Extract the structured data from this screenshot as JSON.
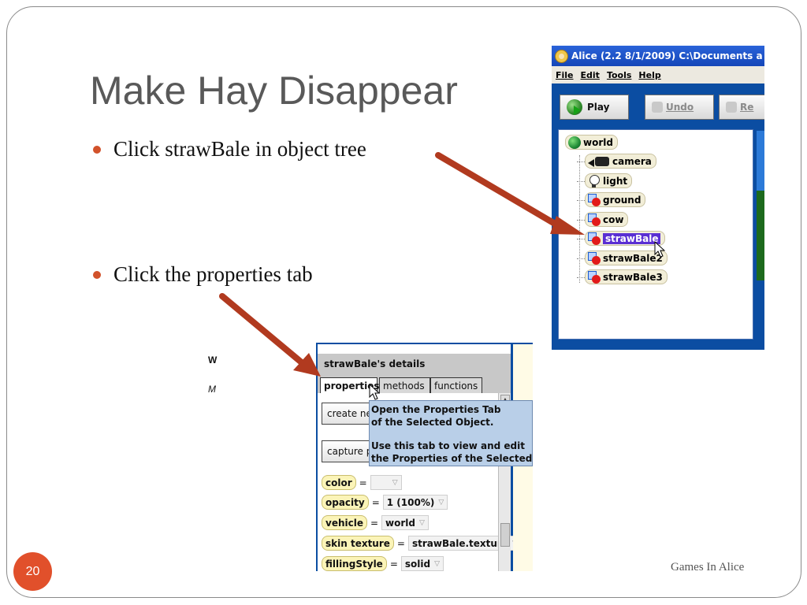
{
  "slide": {
    "title": "Make Hay Disappear",
    "bullets": [
      "Click  strawBale in object tree",
      "Click the properties tab"
    ],
    "page_number": "20",
    "footer": "Games In Alice",
    "colors": {
      "accent": "#e1502b",
      "arrow": "#b13a1f",
      "title": "#595959"
    }
  },
  "alice_window": {
    "title": "Alice (2.2  8/1/2009) C:\\Documents a",
    "menu": [
      "File",
      "Edit",
      "Tools",
      "Help"
    ],
    "toolbar": {
      "play": "Play",
      "undo": "Undo",
      "redo": "Re"
    },
    "tree": {
      "root": "world",
      "items": [
        "camera",
        "light",
        "ground",
        "cow",
        "strawBale",
        "strawBale2",
        "strawBale3"
      ],
      "selected": "strawBale"
    }
  },
  "details_panel": {
    "header": "strawBale's details",
    "tabs": [
      "properties",
      "methods",
      "functions"
    ],
    "active_tab": "properties",
    "buttons": [
      "create ne",
      "capture p"
    ],
    "properties": [
      {
        "name": "color",
        "value": ""
      },
      {
        "name": "opacity",
        "value": "1 (100%)"
      },
      {
        "name": "vehicle",
        "value": "world"
      },
      {
        "name": "skin texture",
        "value": "strawBale.texture"
      },
      {
        "name": "fillingStyle",
        "value": "solid"
      }
    ],
    "side_labels": [
      "W",
      "M"
    ],
    "tooltip": {
      "line1": "Open the Properties Tab",
      "line2": "of the Selected Object.",
      "line3": "Use this tab to view and edit",
      "line4": "the Properties of the Selected Obj"
    }
  }
}
